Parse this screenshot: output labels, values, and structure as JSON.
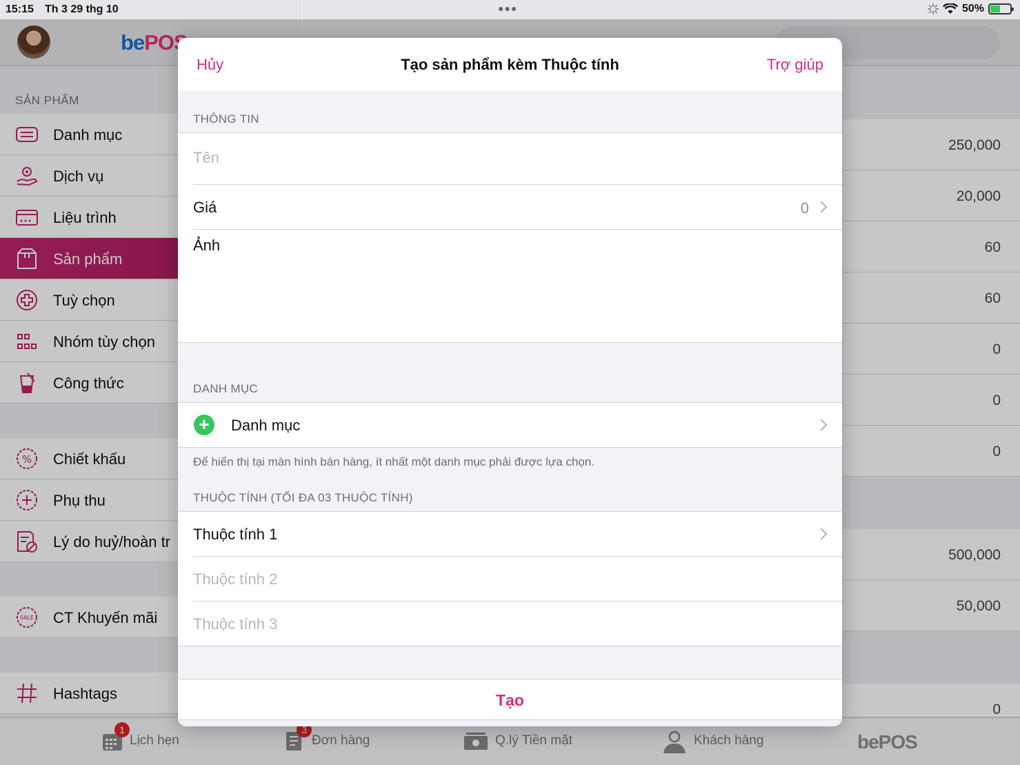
{
  "status": {
    "time": "15:15",
    "date": "Th 3 29 thg 10",
    "battery": "50%"
  },
  "sidebar": {
    "brand_be": "be",
    "brand_pos": "POS",
    "section": "SẢN PHẨM",
    "items": [
      {
        "label": "Danh mục",
        "icon": "list-icon"
      },
      {
        "label": "Dịch vụ",
        "icon": "service-icon"
      },
      {
        "label": "Liệu trình",
        "icon": "card-icon"
      },
      {
        "label": "Sản phẩm",
        "icon": "box-icon"
      },
      {
        "label": "Tuỳ chọn",
        "icon": "plus-circle-icon"
      },
      {
        "label": "Nhóm tùy chọn",
        "icon": "grid-icon"
      },
      {
        "label": "Công thức",
        "icon": "recipe-icon"
      },
      {
        "label": "Chiết khấu",
        "icon": "discount-icon"
      },
      {
        "label": "Phụ thu",
        "icon": "surcharge-icon"
      },
      {
        "label": "Lý do huỷ/hoàn tr",
        "icon": "cancel-reason-icon"
      },
      {
        "label": "CT Khuyến mãi",
        "icon": "sale-icon"
      },
      {
        "label": "Hashtags",
        "icon": "hashtag-icon"
      }
    ]
  },
  "background_values": [
    "250,000",
    "20,000",
    "60",
    "60",
    "0",
    "0",
    "0",
    "500,000",
    "50,000",
    "0"
  ],
  "tabbar": {
    "items": [
      {
        "label": "Lịch hẹn",
        "badge": "1"
      },
      {
        "label": "Đơn hàng",
        "badge": "3"
      },
      {
        "label": "Q.lý Tiền mặt",
        "badge": ""
      },
      {
        "label": "Khách hàng",
        "badge": ""
      }
    ],
    "brand": "bePOS"
  },
  "modal": {
    "cancel": "Hủy",
    "title": "Tạo sản phẩm kèm Thuộc tính",
    "help": "Trợ giúp",
    "info_section": "THÔNG TIN",
    "name_placeholder": "Tên",
    "price_label": "Giá",
    "price_value": "0",
    "image_label": "Ảnh",
    "category_section": "DANH MỤC",
    "category_label": "Danh mục",
    "category_note": "Để hiển thị tại màn hình bán hàng, ít nhất một danh mục phải được lựa chọn.",
    "attr_section": "THUỘC TÍNH (TỐI ĐA 03 THUỘC TÍNH)",
    "attr1": "Thuộc tính 1",
    "attr2": "Thuộc tính 2",
    "attr3": "Thuộc tính 3",
    "create": "Tạo"
  },
  "colors": {
    "accent": "#d42e7e",
    "active_menu": "#b01f60",
    "brand_blue": "#1c6fd1",
    "add_green": "#34c759",
    "badge_red": "#e0241f"
  }
}
